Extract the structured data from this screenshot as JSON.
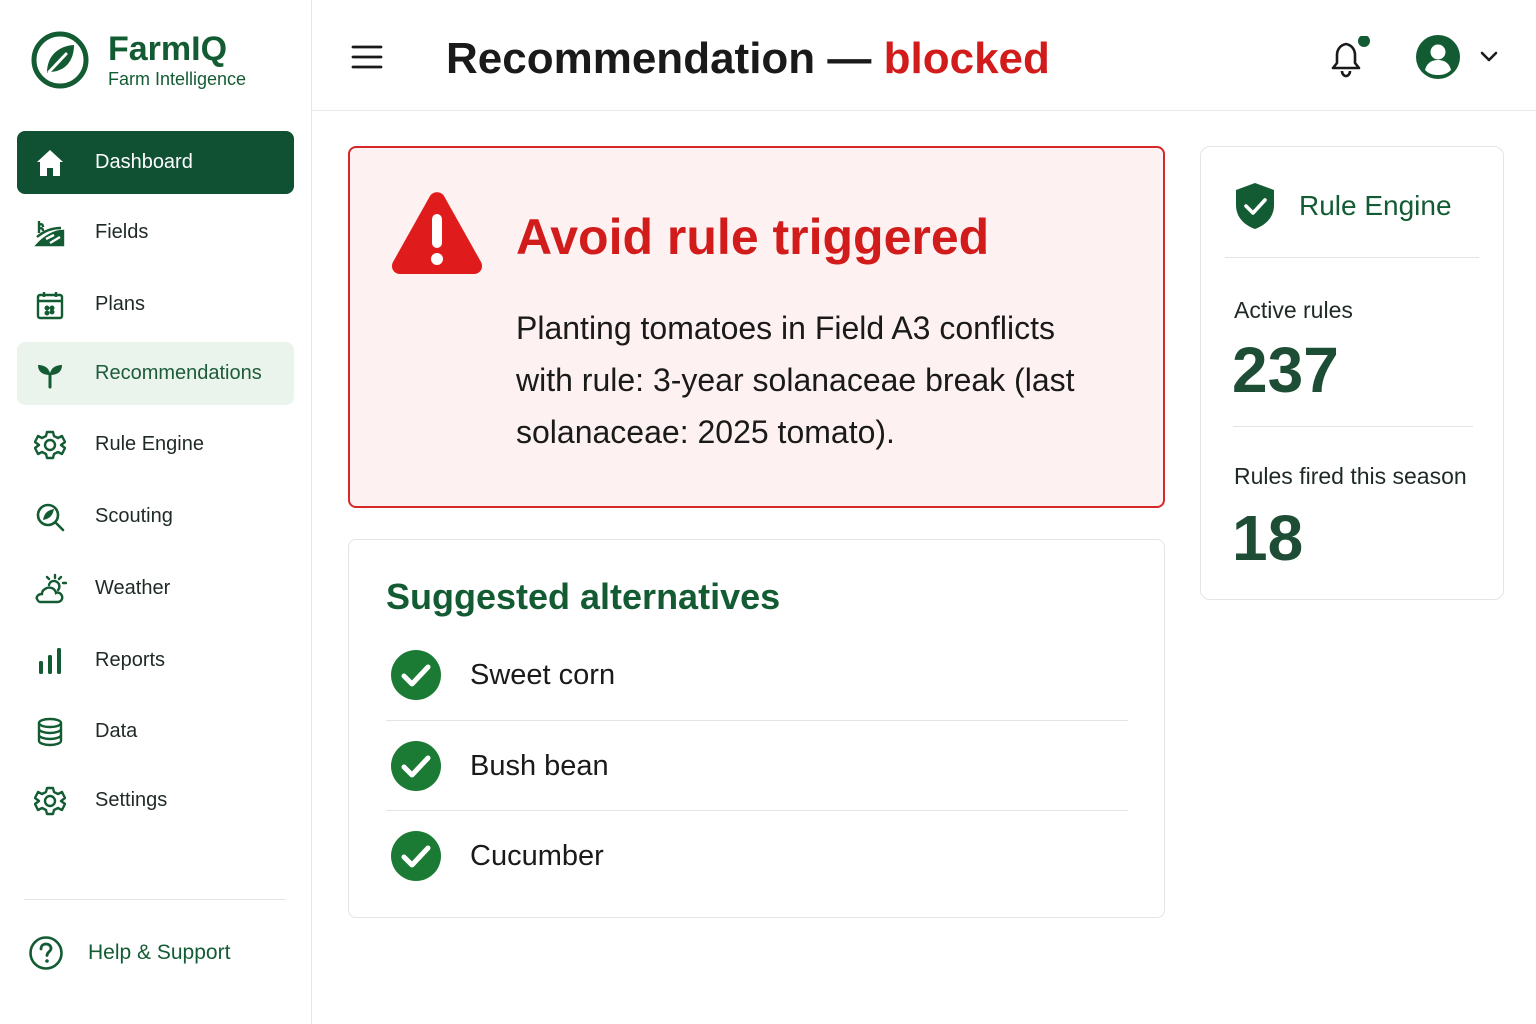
{
  "brand": {
    "name": "FarmIQ",
    "subtitle": "Farm Intelligence"
  },
  "sidebar": {
    "items": [
      {
        "label": "Dashboard",
        "icon": "home-icon",
        "state": "active"
      },
      {
        "label": "Fields",
        "icon": "fields-icon"
      },
      {
        "label": "Plans",
        "icon": "calendar-icon"
      },
      {
        "label": "Recommendations",
        "icon": "sprout-icon",
        "state": "selected"
      },
      {
        "label": "Rule Engine",
        "icon": "gear-icon"
      },
      {
        "label": "Scouting",
        "icon": "search-icon"
      },
      {
        "label": "Weather",
        "icon": "weather-icon"
      },
      {
        "label": "Reports",
        "icon": "bar-chart-icon"
      },
      {
        "label": "Data",
        "icon": "database-icon"
      },
      {
        "label": "Settings",
        "icon": "settings-icon"
      }
    ],
    "help_label": "Help & Support"
  },
  "header": {
    "title_prefix": "Recommendation — ",
    "title_status": "blocked",
    "has_notification": true
  },
  "alert": {
    "title": "Avoid rule triggered",
    "message": "Planting tomatoes in Field A3 conflicts with rule: 3-year solanaceae break (last solanaceae: 2025 tomato)."
  },
  "alternatives": {
    "title": "Suggested alternatives",
    "items": [
      "Sweet corn",
      "Bush bean",
      "Cucumber"
    ]
  },
  "rule_engine": {
    "title": "Rule Engine",
    "active_rules_label": "Active rules",
    "active_rules_value": "237",
    "fired_label": "Rules fired this season",
    "fired_value": "18"
  },
  "colors": {
    "brand_green": "#135c33",
    "active_nav": "#0f5132",
    "alert_red": "#d21c1c",
    "alert_bg": "#fdf1f1",
    "check_green": "#1b7a33"
  }
}
